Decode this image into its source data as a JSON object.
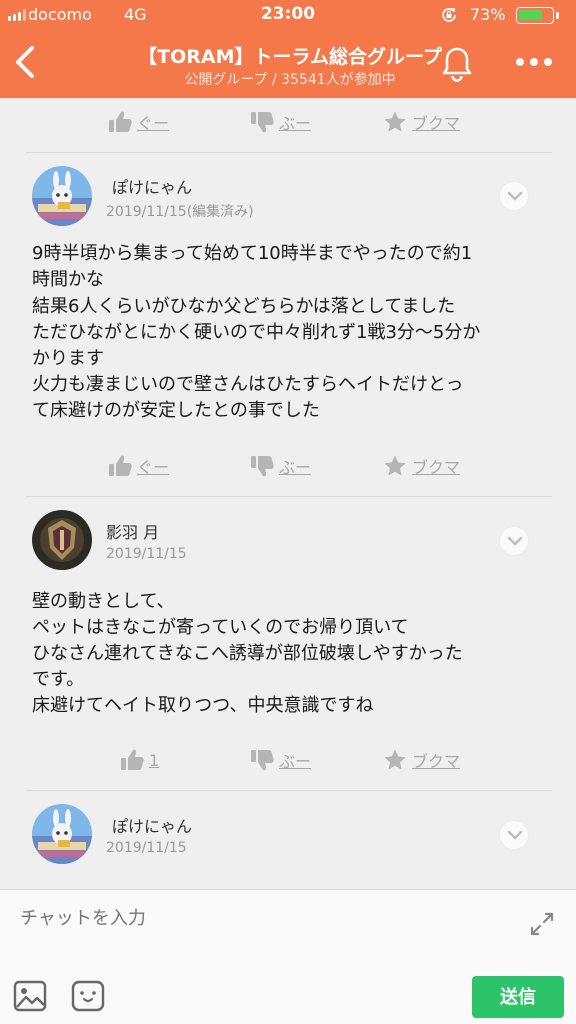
{
  "status_bar": {
    "carrier": "docomo",
    "network": "4G",
    "time": "23:00",
    "battery_percent": "73%",
    "battery_level": 0.73,
    "battery_color": "#58d35a"
  },
  "header": {
    "title": "【TORAM】トーラム総合グループ",
    "subtitle": "公開グループ / 35541人が参加中",
    "background_color": "#f5784a",
    "icons": [
      "back-chevron-icon",
      "bell-icon",
      "more-dots-icon"
    ]
  },
  "reactions": {
    "like_label": "ぐー",
    "dislike_label": "ぶー",
    "bookmark_label": "ブクマ"
  },
  "posts": [
    {
      "username": "ぽけにゃん",
      "date": "2019/11/15(編集済み)",
      "body": [
        "9時半頃から集まって始めて10時半までやったので約1",
        "時間かな",
        "結果6人くらいがひなか父どちらかは落としてました",
        "ただひながとにかく硬いので中々削れず1戦3分〜5分か",
        "かります",
        "火力も凄まじいので壁さんはひたすらヘイトだけとっ",
        "て床避けのが安定したとの事でした"
      ],
      "like_label": "ぐー"
    },
    {
      "username": "影羽 月",
      "date": "2019/11/15",
      "body": [
        "壁の動きとして、",
        "ペットはきなこが寄っていくのでお帰り頂いて",
        "ひなさん連れてきなこへ誘導が部位破壊しやすかった",
        "です。",
        "床避けてヘイト取りつつ、中央意識ですね"
      ],
      "like_label": "1"
    },
    {
      "username": "ぽけにゃん",
      "date": "2019/11/15",
      "body": []
    }
  ],
  "composer": {
    "placeholder": "チャットを入力",
    "send_label": "送信",
    "send_color": "#2dc36a"
  }
}
